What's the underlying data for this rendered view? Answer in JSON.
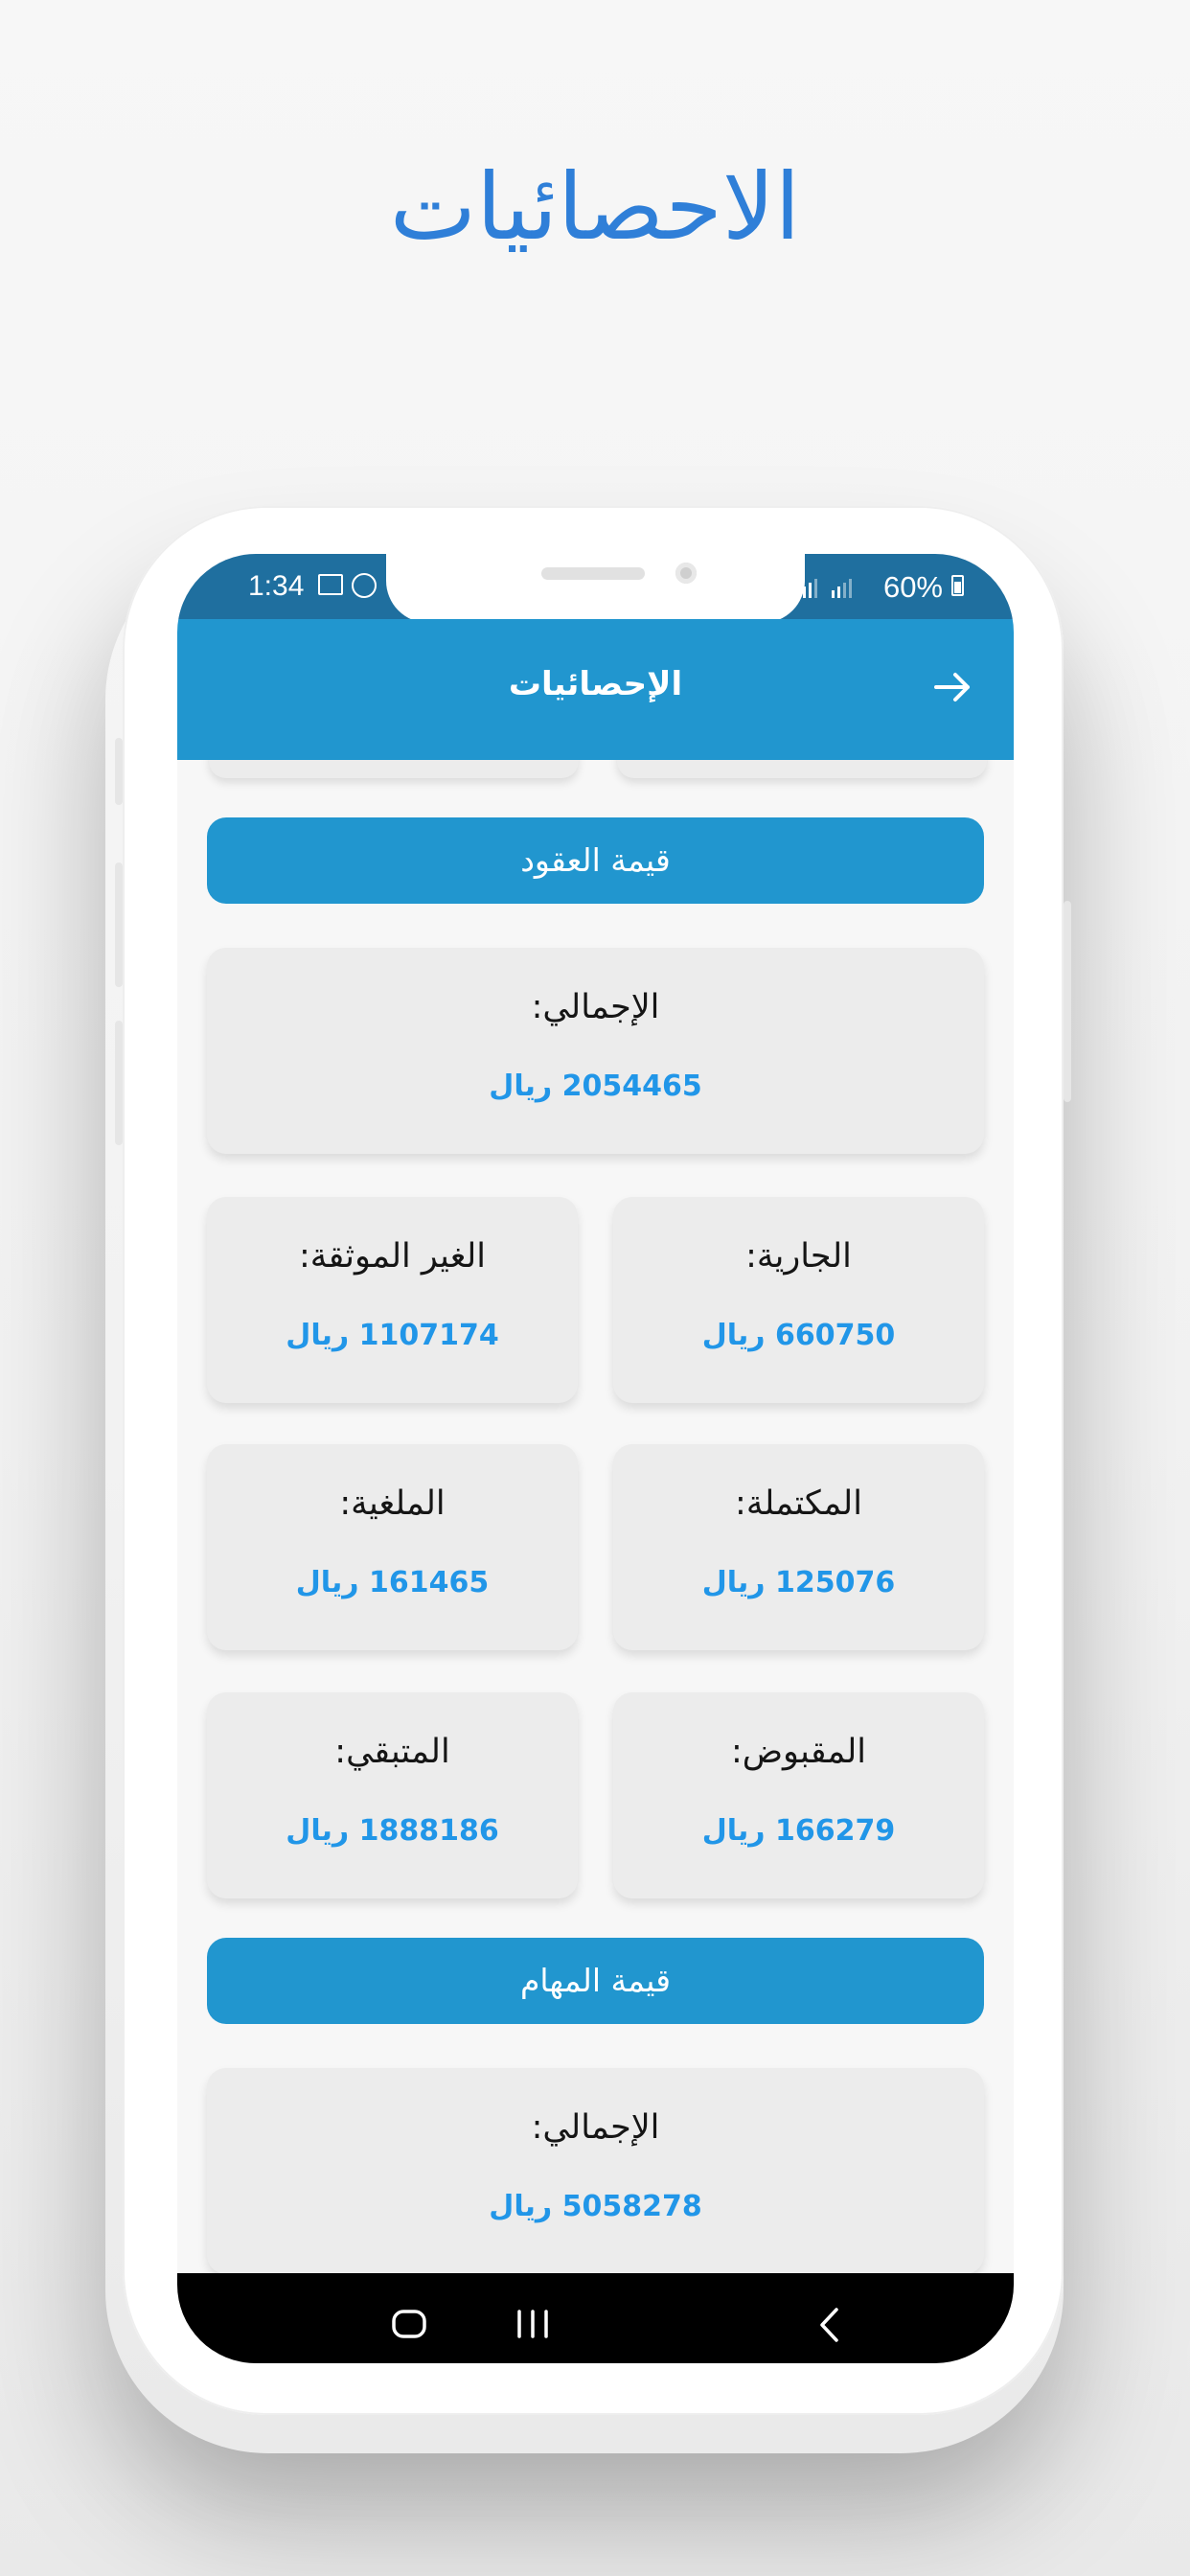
{
  "hero": {
    "title": "الاحصائيات"
  },
  "status_bar": {
    "time": "1:34",
    "battery": "60%",
    "icons": [
      "gallery-icon",
      "app-notification-icon",
      "signal-icon",
      "signal-icon",
      "battery-icon"
    ]
  },
  "appbar": {
    "title": "الإحصائيات",
    "back_icon": "arrow-right-icon"
  },
  "contracts_section": {
    "header": "قيمة العقود",
    "total": {
      "label": "الإجمالي:",
      "value": "2054465 ريال"
    },
    "cards": [
      {
        "label": "الجارية:",
        "value": "660750 ريال"
      },
      {
        "label": "الغير الموثقة:",
        "value": "1107174 ريال"
      },
      {
        "label": "المكتملة:",
        "value": "125076 ريال"
      },
      {
        "label": "الملغية:",
        "value": "161465 ريال"
      },
      {
        "label": "المقبوض:",
        "value": "166279 ريال"
      },
      {
        "label": "المتبقي:",
        "value": "1888186 ريال"
      }
    ]
  },
  "tasks_section": {
    "header": "قيمة المهام",
    "total": {
      "label": "الإجمالي:",
      "value": "5058278 ريال"
    }
  },
  "navigation_bar": {
    "icons": [
      "recent-apps-icon",
      "home-icon",
      "back-icon"
    ]
  },
  "colors": {
    "hero_text": "#2f7fd8",
    "status_bar": "#1f6f9f",
    "primary": "#2196cf",
    "value_text": "#2196e8",
    "card_background": "#ececec",
    "navigation_background": "#000000"
  }
}
